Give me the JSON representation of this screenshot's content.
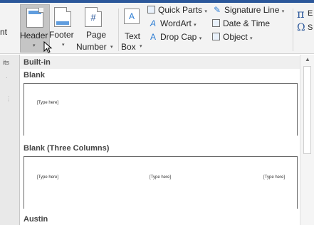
{
  "ribbon": {
    "partial_left": "nt",
    "header": {
      "label": "Header",
      "caret": "▾"
    },
    "footer": {
      "label": "Footer",
      "caret": "▾"
    },
    "page_number": {
      "label_line1": "Page",
      "label_line2": "Number",
      "caret": "▾",
      "icon": "#"
    },
    "text_box": {
      "label_line1": "Text",
      "label_line2": "Box",
      "caret": "▾",
      "icon": "A"
    },
    "quick_parts": {
      "label": "Quick Parts",
      "caret": "▾"
    },
    "wordart": {
      "label": "WordArt",
      "caret": "▾",
      "icon": "A"
    },
    "drop_cap": {
      "label": "Drop Cap",
      "caret": "▾",
      "icon": "A"
    },
    "signature_line": {
      "label": "Signature Line",
      "caret": "▾"
    },
    "date_time": {
      "label": "Date & Time"
    },
    "object": {
      "label": "Object",
      "caret": "▾"
    },
    "equation_icon": "π",
    "equation_partial": "E",
    "symbol_icon": "Ω",
    "symbol_partial": "S",
    "accent_color": "#2b579a"
  },
  "left_strip": {
    "partial_label": "its"
  },
  "gallery": {
    "section_title": "Built-in",
    "scroll_up_icon": "▲",
    "items": [
      {
        "name": "Blank",
        "placeholders": [
          "[Type here]"
        ]
      },
      {
        "name": "Blank (Three Columns)",
        "placeholders": [
          "[Type here]",
          "[Type here]",
          "[Type here]"
        ]
      },
      {
        "name": "Austin"
      }
    ]
  }
}
